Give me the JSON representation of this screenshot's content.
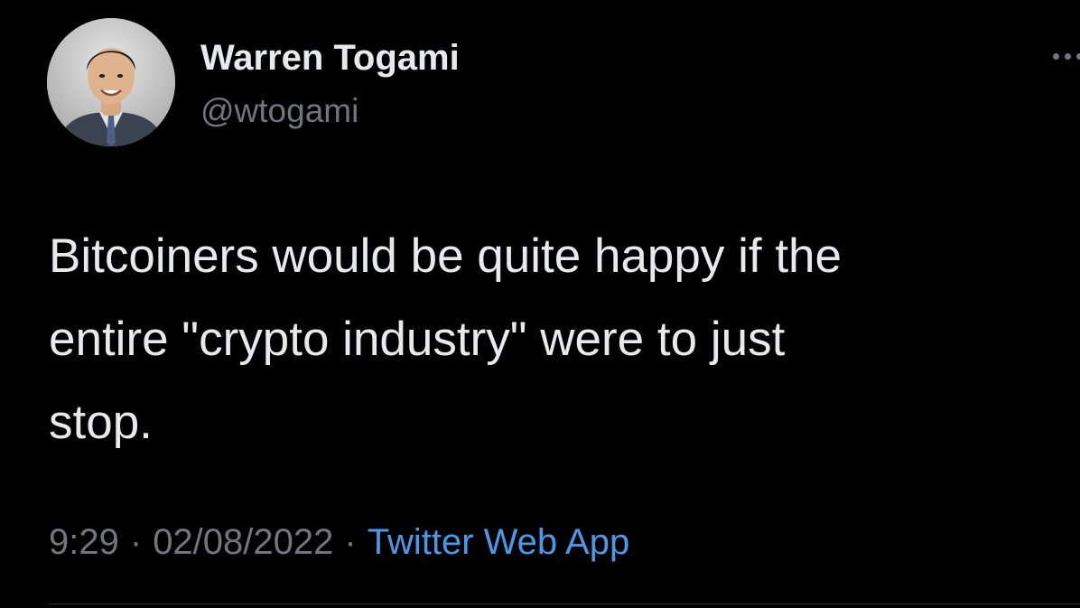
{
  "tweet": {
    "author": {
      "display_name": "Warren Togami",
      "handle": "@wtogami",
      "avatar_icon": "profile-photo"
    },
    "more_icon": "more-options-icon",
    "text": "Bitcoiners would be quite happy if the\nentire \"crypto industry\" were to just\nstop.",
    "time": "9:29",
    "date": "02/08/2022",
    "separator": "·",
    "source": "Twitter Web App"
  },
  "colors": {
    "background": "#000000",
    "primary_text": "#e7e9ea",
    "secondary_text": "#71767b",
    "link": "#4a99e9",
    "divider": "#2f3336"
  }
}
